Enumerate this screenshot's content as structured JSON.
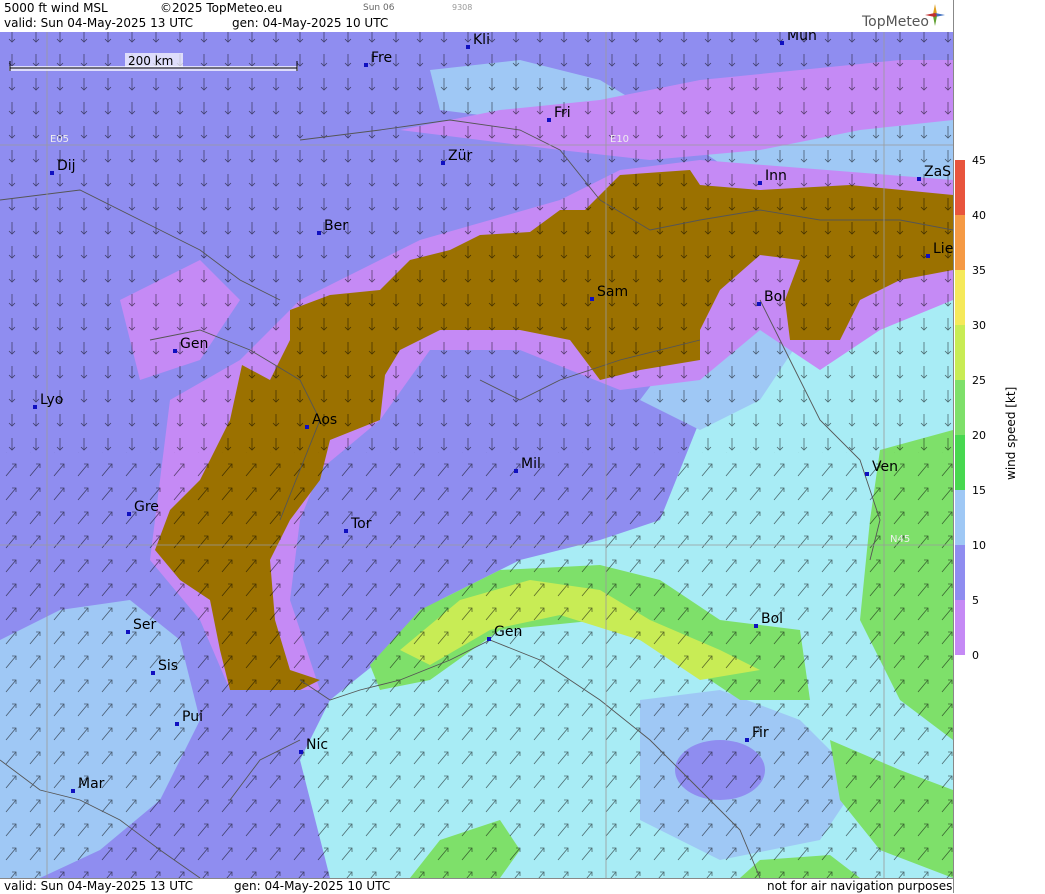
{
  "header": {
    "title": "5000 ft wind MSL",
    "copyright": "©2025 TopMeteo.eu",
    "tab_label": "Sun 06",
    "tab_code": "9308",
    "valid": "valid:  Sun  04-May-2025  13 UTC",
    "gen": "gen: 04-May-2025 10 UTC",
    "brand": "TopMeteo"
  },
  "footer": {
    "valid": "valid:  Sun  04-May-2025  13 UTC",
    "gen": "gen: 04-May-2025 10 UTC",
    "disclaimer": "not for air navigation purposes"
  },
  "scale": {
    "label": "200 km"
  },
  "grid_labels": [
    {
      "name": "E05"
    },
    {
      "name": "E10"
    },
    {
      "name": "N45"
    }
  ],
  "cities": [
    "Kli",
    "Mün",
    "Fre",
    "Fri",
    "Dij",
    "Zür",
    "Inn",
    "ZaS",
    "Ber",
    "Lie",
    "Sam",
    "Bol",
    "Gen",
    "Lyo",
    "Aos",
    "Mil",
    "Ven",
    "Gre",
    "Tor",
    "Ser",
    "Gen",
    "Bol",
    "Sis",
    "Pui",
    "Nic",
    "Fir",
    "Mar"
  ],
  "colors": {
    "terrain": "#9b7100",
    "purple": "#b97ef5",
    "blue_violet": "#8f8df0",
    "light_blue": "#9fc8f5",
    "cyan": "#a8ecf5",
    "green": "#7ee06a",
    "yellow_green": "#c8ec55",
    "city_marker": "#1010c0"
  },
  "legend": {
    "unit_label": "wind speed [kt]",
    "ticks": [
      "45",
      "40",
      "35",
      "30",
      "25",
      "20",
      "15",
      "10",
      "5",
      "0"
    ],
    "bands": [
      {
        "from": 40,
        "to": 45,
        "color": "#e8553d"
      },
      {
        "from": 35,
        "to": 40,
        "color": "#f59a45"
      },
      {
        "from": 30,
        "to": 35,
        "color": "#f5e95a"
      },
      {
        "from": 25,
        "to": 30,
        "color": "#c8ec55"
      },
      {
        "from": 20,
        "to": 25,
        "color": "#7ee06a"
      },
      {
        "from": 15,
        "to": 20,
        "color": "#48d850"
      },
      {
        "from": 10,
        "to": 15,
        "color": "#9fc8f5"
      },
      {
        "from": 5,
        "to": 10,
        "color": "#8f8df0"
      },
      {
        "from": 0,
        "to": 5,
        "color": "#c58af5"
      }
    ]
  }
}
